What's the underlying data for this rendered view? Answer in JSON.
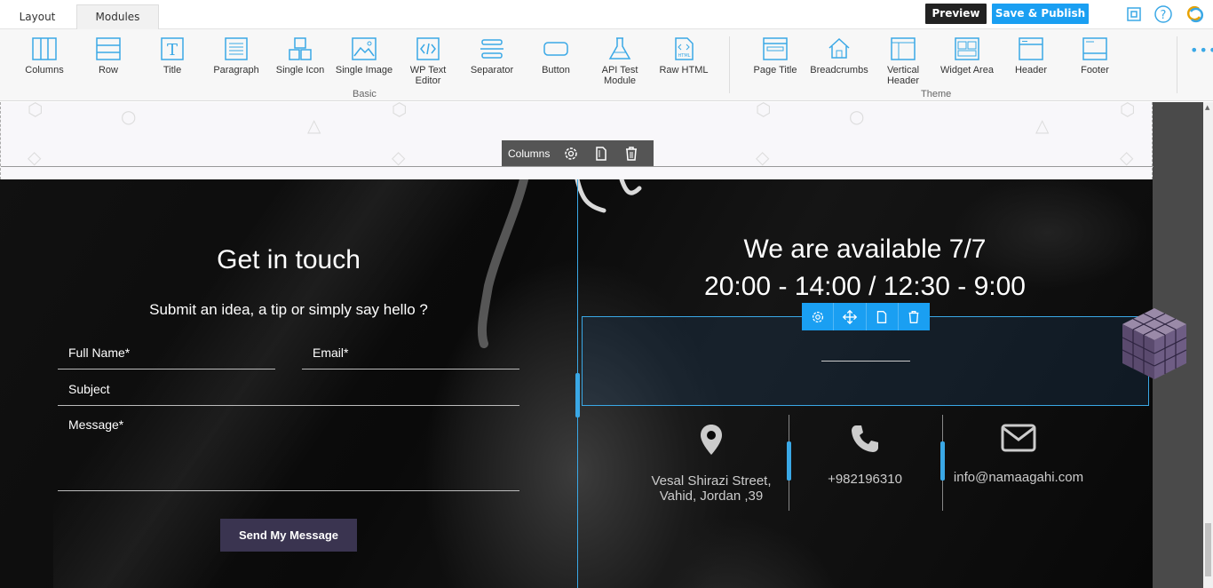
{
  "tabs": [
    {
      "label": "Layout"
    },
    {
      "label": "Modules"
    }
  ],
  "top_actions": {
    "preview": "Preview",
    "publish": "Save & Publish"
  },
  "modules": {
    "basic": [
      {
        "label": "Columns",
        "icon": "columns-icon"
      },
      {
        "label": "Row",
        "icon": "row-icon"
      },
      {
        "label": "Title",
        "icon": "title-icon"
      },
      {
        "label": "Paragraph",
        "icon": "paragraph-icon"
      },
      {
        "label": "Single Icon",
        "icon": "single-icon-icon"
      },
      {
        "label": "Single Image",
        "icon": "image-icon"
      },
      {
        "label": "WP Text Editor",
        "icon": "code-icon"
      },
      {
        "label": "Separator",
        "icon": "separator-icon"
      },
      {
        "label": "Button",
        "icon": "button-icon"
      },
      {
        "label": "API Test Module",
        "icon": "flask-icon"
      },
      {
        "label": "Raw HTML",
        "icon": "html-file-icon"
      }
    ],
    "theme": [
      {
        "label": "Page Title",
        "icon": "page-title-icon"
      },
      {
        "label": "Breadcrumbs",
        "icon": "home-icon"
      },
      {
        "label": "Vertical Header",
        "icon": "vertical-header-icon"
      },
      {
        "label": "Widget Area",
        "icon": "widget-area-icon"
      },
      {
        "label": "Header",
        "icon": "header-icon"
      },
      {
        "label": "Footer",
        "icon": "footer-icon"
      }
    ],
    "group_basic": "Basic",
    "group_theme": "Theme"
  },
  "columns_bar": {
    "label": "Columns"
  },
  "contact": {
    "title": "Get in touch",
    "subtitle": "Submit an idea, a tip or simply say hello ?",
    "fields": {
      "name": "Full Name*",
      "email": "Email*",
      "subject": "Subject",
      "message": "Message*"
    },
    "send": "Send My Message"
  },
  "availability": {
    "title": "We are available 7/7",
    "hours": "20:00 - 14:00 / 12:30 - 9:00"
  },
  "info": {
    "address": "Vesal Shirazi Street, Vahid, Jordan ,39",
    "phone": "+982196310",
    "email": "info@namaagahi.com"
  },
  "colors": {
    "accent": "#1a9ff2",
    "send_button": "#3a3450"
  }
}
